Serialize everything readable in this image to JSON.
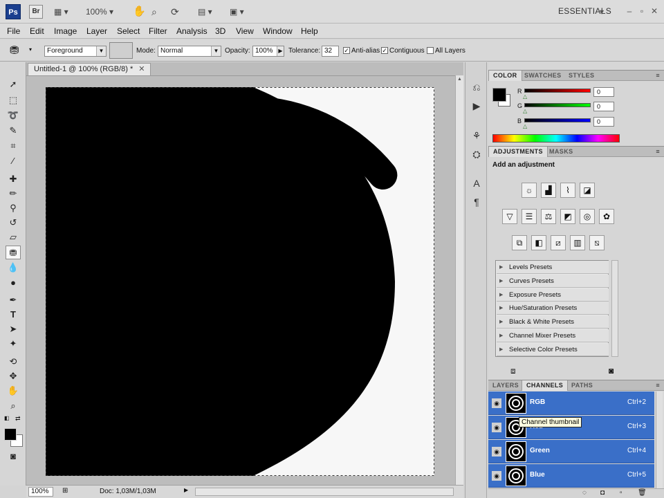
{
  "app": {
    "logo": "Ps",
    "bridge": "Br",
    "zoom_value": "100%",
    "workspace": "ESSENTIALS",
    "window_controls": [
      "minimize",
      "restore",
      "close"
    ]
  },
  "menu": [
    "File",
    "Edit",
    "Image",
    "Layer",
    "Select",
    "Filter",
    "Analysis",
    "3D",
    "View",
    "Window",
    "Help"
  ],
  "options": {
    "fill_source": "Foreground",
    "mode_label": "Mode:",
    "mode_value": "Normal",
    "opacity_label": "Opacity:",
    "opacity_value": "100%",
    "tolerance_label": "Tolerance:",
    "tolerance_value": "32",
    "antialias_label": "Anti-alias",
    "antialias_checked": true,
    "contiguous_label": "Contiguous",
    "contiguous_checked": true,
    "all_layers_label": "All Layers",
    "all_layers_checked": false
  },
  "document": {
    "tab_title": "Untitled-1 @ 100% (RGB/8) *",
    "status_zoom": "100%",
    "status_doc": "Doc: 1,03M/1,03M"
  },
  "color_panel": {
    "tabs": [
      "COLOR",
      "SWATCHES",
      "STYLES"
    ],
    "r_label": "R",
    "r_value": "0",
    "g_label": "G",
    "g_value": "0",
    "b_label": "B",
    "b_value": "0"
  },
  "adjustments_panel": {
    "tabs": [
      "ADJUSTMENTS",
      "MASKS"
    ],
    "heading": "Add an adjustment",
    "presets": [
      "Levels Presets",
      "Curves Presets",
      "Exposure Presets",
      "Hue/Saturation Presets",
      "Black & White Presets",
      "Channel Mixer Presets",
      "Selective Color Presets"
    ]
  },
  "layers_panel": {
    "tabs": [
      "LAYERS",
      "CHANNELS",
      "PATHS"
    ],
    "channels": [
      {
        "name": "RGB",
        "shortcut": "Ctrl+2"
      },
      {
        "name": "Red",
        "shortcut": "Ctrl+3"
      },
      {
        "name": "Green",
        "shortcut": "Ctrl+4"
      },
      {
        "name": "Blue",
        "shortcut": "Ctrl+5"
      }
    ],
    "tooltip": "Channel thumbnail"
  },
  "colors": {
    "selection_blue": "#3a6fc8",
    "foreground": "#000000",
    "background": "#ffffff"
  }
}
